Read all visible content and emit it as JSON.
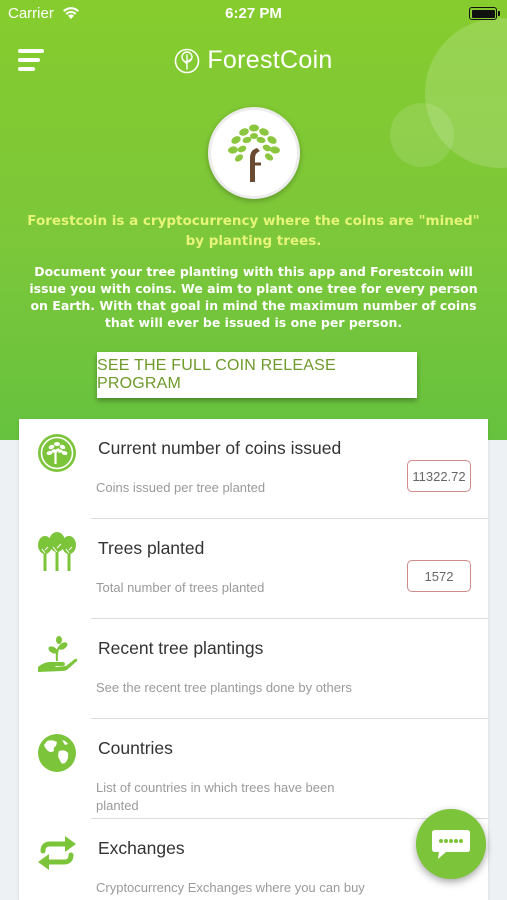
{
  "status_bar": {
    "carrier": "Carrier",
    "time": "6:27 PM"
  },
  "header": {
    "brand": "ForestCoin"
  },
  "hero": {
    "tagline": "Forestcoin is a cryptocurrency where the coins are \"mined\" by planting trees.",
    "description": "Document your tree planting with this app and Forestcoin will issue you with coins. We aim to plant one tree for every person on Earth. With that goal in mind the maximum number of coins that will ever be issued is one per person.",
    "cta_label": "SEE THE FULL COIN RELEASE PROGRAM"
  },
  "rows": [
    {
      "icon": "tree-coin-icon",
      "title": "Current number of coins issued",
      "subtitle": "Coins issued per tree planted",
      "value": "11322.72"
    },
    {
      "icon": "trees-icon",
      "title": "Trees planted",
      "subtitle": "Total number of trees planted",
      "value": "1572"
    },
    {
      "icon": "sprout-hand-icon",
      "title": "Recent tree plantings",
      "subtitle": "See the recent tree plantings done by others"
    },
    {
      "icon": "globe-icon",
      "title": "Countries",
      "subtitle": "List of countries in which trees have been planted"
    },
    {
      "icon": "exchange-arrows-icon",
      "title": "Exchanges",
      "subtitle": "Cryptocurrency Exchanges where you can buy"
    }
  ],
  "colors": {
    "brand_green": "#7cc43a",
    "tagline_yellow": "#e6f57a",
    "cta_text": "#6e9a2a",
    "badge_border": "#d08a8a"
  }
}
